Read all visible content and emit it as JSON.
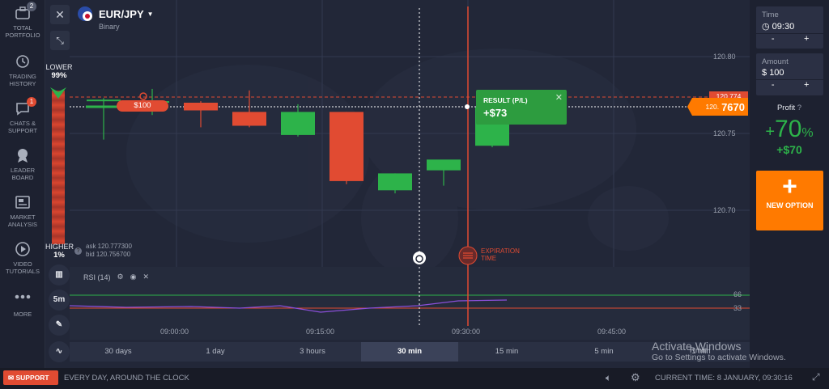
{
  "sidebar": {
    "items": [
      {
        "label": "TOTAL PORTFOLIO",
        "badge": "2",
        "icon": "briefcase-icon"
      },
      {
        "label": "TRADING HISTORY",
        "icon": "history-icon"
      },
      {
        "label": "CHATS & SUPPORT",
        "badge": "1",
        "icon": "chat-icon"
      },
      {
        "label": "LEADER BOARD",
        "icon": "trophy-icon"
      },
      {
        "label": "MARKET ANALYSIS",
        "icon": "newspaper-icon"
      },
      {
        "label": "VIDEO TUTORIALS",
        "icon": "play-icon"
      },
      {
        "label": "MORE",
        "icon": "more-icon"
      }
    ]
  },
  "asset": {
    "name": "EUR/JPY",
    "type": "Binary"
  },
  "sentiment": {
    "lower_label": "LOWER",
    "lower_pct": "99%",
    "higher_label": "HIGHER",
    "higher_pct": "1%"
  },
  "quote": {
    "ask": "ask 120.777300",
    "bid": "bid 120.756700"
  },
  "price_axis": [
    "120.80",
    "120.75",
    "120.70"
  ],
  "price_tag": {
    "strike": "120.774",
    "current_prefix": "120.",
    "current_suffix": "7670"
  },
  "position": {
    "amount": "$100"
  },
  "result": {
    "label": "RESULT (P/L)",
    "value": "+$73"
  },
  "expiration": {
    "label": "EXPIRATION TIME"
  },
  "indicator": {
    "name": "RSI (14)",
    "levels": [
      "66",
      "33"
    ]
  },
  "time_axis": [
    "09:00:00",
    "09:15:00",
    "09:30:00",
    "09:45:00"
  ],
  "extra_time_label": "Rmin",
  "interval": "5m",
  "timeframes": [
    {
      "label": "30 days",
      "active": false
    },
    {
      "label": "1 day",
      "active": false
    },
    {
      "label": "3 hours",
      "active": false
    },
    {
      "label": "30 min",
      "active": true
    },
    {
      "label": "15 min",
      "active": false
    },
    {
      "label": "5 min",
      "active": false
    },
    {
      "label": "1 min",
      "active": false
    }
  ],
  "right_panel": {
    "time_label": "Time",
    "time_value": "09:30",
    "amount_label": "Amount",
    "amount_value": "100",
    "amount_currency": "$",
    "minus": "-",
    "plus": "+",
    "profit_label": "Profit",
    "profit_pct_sign": "+",
    "profit_pct": "70",
    "profit_pct_unit": "%",
    "profit_value": "+$70",
    "new_option_label": "NEW OPTION"
  },
  "bottom": {
    "support_label": "SUPPORT",
    "tagline": "EVERY DAY, AROUND THE CLOCK",
    "current_time": "CURRENT TIME: 8 JANUARY, 09:30:16"
  },
  "watermark": {
    "title": "Activate Windows",
    "subtitle": "Go to Settings to activate Windows."
  },
  "colors": {
    "up": "#2db34a",
    "down": "#e14b32",
    "accent": "#ff7a00",
    "background": "#222738"
  },
  "candles": [
    {
      "time": "08:45",
      "open": 120.772,
      "high": 120.773,
      "low": 120.746,
      "close": 120.772
    },
    {
      "time": "08:50",
      "open": 120.771,
      "high": 120.779,
      "low": 120.762,
      "close": 120.771
    },
    {
      "time": "08:55",
      "open": 120.77,
      "high": 120.771,
      "low": 120.754,
      "close": 120.765
    },
    {
      "time": "09:00",
      "open": 120.764,
      "high": 120.778,
      "low": 120.754,
      "close": 120.755
    },
    {
      "time": "09:05",
      "open": 120.749,
      "high": 120.769,
      "low": 120.748,
      "close": 120.764
    },
    {
      "time": "09:10",
      "open": 120.764,
      "high": 120.764,
      "low": 120.717,
      "close": 120.719
    },
    {
      "time": "09:15",
      "open": 120.713,
      "high": 120.724,
      "low": 120.711,
      "close": 120.724
    },
    {
      "time": "09:20",
      "open": 120.726,
      "high": 120.73,
      "low": 120.716,
      "close": 120.733
    },
    {
      "time": "09:25",
      "open": 120.742,
      "high": 120.773,
      "low": 120.741,
      "close": 120.767
    }
  ]
}
